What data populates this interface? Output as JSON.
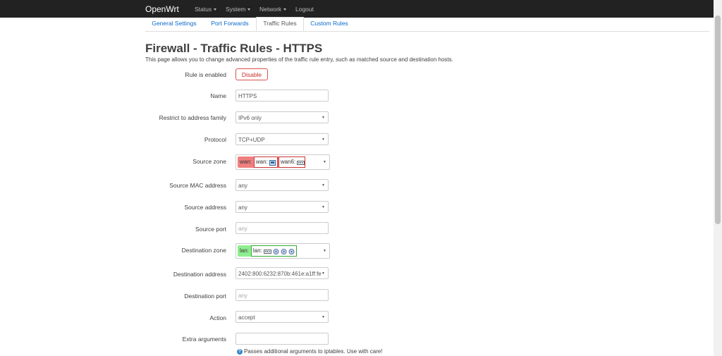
{
  "nav": {
    "brand": "OpenWrt",
    "menus": [
      {
        "label": "Status",
        "dropdown": true
      },
      {
        "label": "System",
        "dropdown": true
      },
      {
        "label": "Network",
        "dropdown": true
      },
      {
        "label": "Logout",
        "dropdown": false
      }
    ]
  },
  "tabs": [
    {
      "label": "General Settings",
      "active": false
    },
    {
      "label": "Port Forwards",
      "active": false
    },
    {
      "label": "Traffic Rules",
      "active": true
    },
    {
      "label": "Custom Rules",
      "active": false
    }
  ],
  "page": {
    "title": "Firewall - Traffic Rules - HTTPS",
    "description": "This page allows you to change advanced properties of the traffic rule entry, such as matched source and destination hosts."
  },
  "form": {
    "rule_enabled": {
      "label": "Rule is enabled",
      "button": "Disable"
    },
    "name": {
      "label": "Name",
      "value": "HTTPS"
    },
    "family": {
      "label": "Restrict to address family",
      "value": "IPv6 only"
    },
    "protocol": {
      "label": "Protocol",
      "value": "TCP+UDP"
    },
    "source_zone": {
      "label": "Source zone",
      "zone": "wan:",
      "networks": [
        "wan:",
        "wan6:"
      ],
      "color": "#f08080",
      "border": "#cc3333"
    },
    "source_mac": {
      "label": "Source MAC address",
      "value": "any"
    },
    "source_address": {
      "label": "Source address",
      "value": "any"
    },
    "source_port": {
      "label": "Source port",
      "placeholder": "any"
    },
    "dest_zone": {
      "label": "Destination zone",
      "zone": "lan:",
      "networks": [
        "lan:"
      ],
      "color": "#90ee90",
      "border": "#33aa33"
    },
    "dest_address": {
      "label": "Destination address",
      "value": "2402:800:6232:870b:461e:a1ff:fe"
    },
    "dest_port": {
      "label": "Destination port",
      "placeholder": "any"
    },
    "action": {
      "label": "Action",
      "value": "accept"
    },
    "extra_args": {
      "label": "Extra arguments",
      "value": "",
      "help": "Passes additional arguments to iptables. Use with care!"
    }
  }
}
